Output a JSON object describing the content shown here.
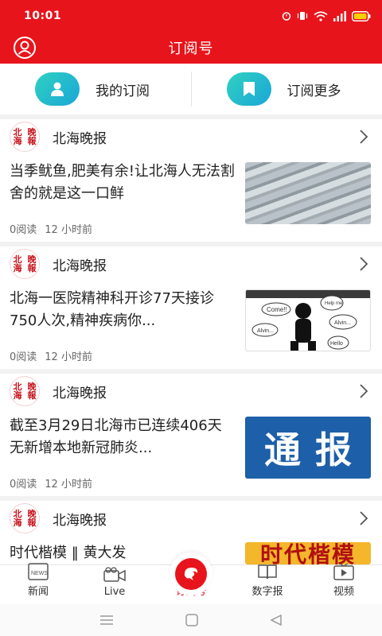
{
  "status_bar": {
    "time": "10:01"
  },
  "header": {
    "title": "订阅号"
  },
  "subscribe_bar": {
    "my_label": "我的订阅",
    "more_label": "订阅更多"
  },
  "feed": [
    {
      "source": "北海晚报",
      "title": "当季鱿鱼,肥美有余!让北海人无法割舍的就是这一口鲜",
      "reads": "0阅读",
      "time": "12 小时前",
      "thumb": "squid-photo"
    },
    {
      "source": "北海晚报",
      "title": "北海一医院精神科开诊77天接诊750人次,精神疾病你...",
      "reads": "0阅读",
      "time": "12 小时前",
      "thumb": "cartoon-illustration",
      "thumb_bubbles": [
        "Come!!",
        "Help me",
        "Alvin...",
        "Alvin...",
        "Hello"
      ]
    },
    {
      "source": "北海晚报",
      "title": "截至3月29日北海市已连续406天无新增本地新冠肺炎...",
      "reads": "0阅读",
      "time": "12 小时前",
      "thumb": "notice-banner",
      "thumb_text": [
        "通",
        "报"
      ]
    },
    {
      "source": "北海晚报",
      "title": "时代楷模 ‖ 黄大发",
      "thumb": "model-banner",
      "thumb_text": "时代楷模"
    }
  ],
  "source_logo_text": [
    "北海",
    "晚報"
  ],
  "bottom_nav": [
    {
      "label": "新闻",
      "icon": "news-icon"
    },
    {
      "label": "Live",
      "icon": "camera-icon"
    },
    {
      "label": "订阅号",
      "icon": "subscribe-icon",
      "active": true
    },
    {
      "label": "数字报",
      "icon": "book-icon"
    },
    {
      "label": "视频",
      "icon": "tv-icon"
    }
  ],
  "colors": {
    "brand": "#e8141b",
    "accent_gradient": [
      "#2fd1c0",
      "#1aa6d8"
    ]
  }
}
